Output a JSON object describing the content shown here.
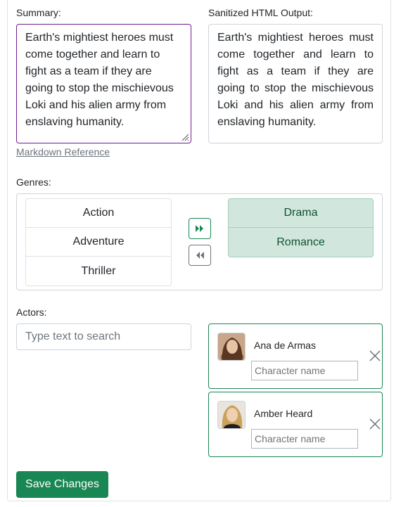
{
  "summary": {
    "label": "Summary:",
    "text": "Earth's mightiest heroes must come together and learn to fight as a team if they are going to stop the mischievous Loki and his alien army from enslaving humanity."
  },
  "output": {
    "label": "Sanitized HTML Output:",
    "text": "Earth's mightiest heroes must come together and learn to fight as a team if they are going to stop the mischievous Loki and his alien army from enslaving humanity."
  },
  "markdown_link": "Markdown Reference",
  "genres": {
    "label": "Genres:",
    "available": [
      "Action",
      "Adventure",
      "Thriller"
    ],
    "selected": [
      "Drama",
      "Romance"
    ],
    "move_right_icon": "double-chevron-right-icon",
    "move_left_icon": "double-chevron-left-icon"
  },
  "actors": {
    "label": "Actors:",
    "search_placeholder": "Type text to search",
    "selected": [
      {
        "name": "Ana de Armas",
        "character_placeholder": "Character name"
      },
      {
        "name": "Amber Heard",
        "character_placeholder": "Character name"
      }
    ],
    "remove_icon": "close-icon"
  },
  "save_label": "Save Changes",
  "colors": {
    "accent": "#198754",
    "selected_bg": "#d1e7dd",
    "focus_border": "#6f1d8f"
  }
}
